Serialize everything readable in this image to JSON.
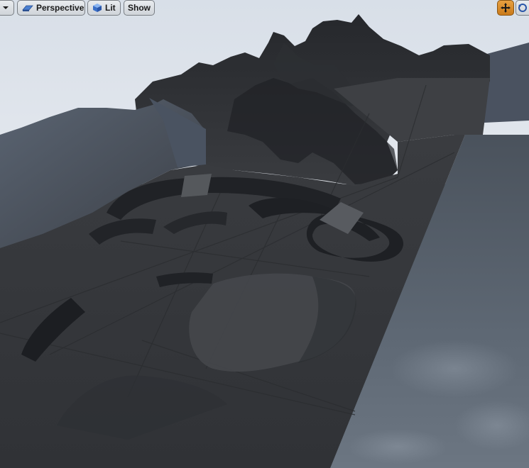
{
  "viewport": {
    "toolbar": {
      "menu_icon": "chevron-down-icon",
      "view_mode_label": "Perspective",
      "view_mode_icon": "perspective-icon",
      "lighting_label": "Lit",
      "lighting_icon": "lit-cube-icon",
      "show_label": "Show",
      "transform_icon": "move-transform-icon",
      "rotate_icon": "rotate-icon",
      "active_tool_color": "#d98b28"
    },
    "scene": {
      "sky_color": "#dbe2ea",
      "terrain_color": "#3c3e42",
      "water_color": "#56606c"
    }
  }
}
